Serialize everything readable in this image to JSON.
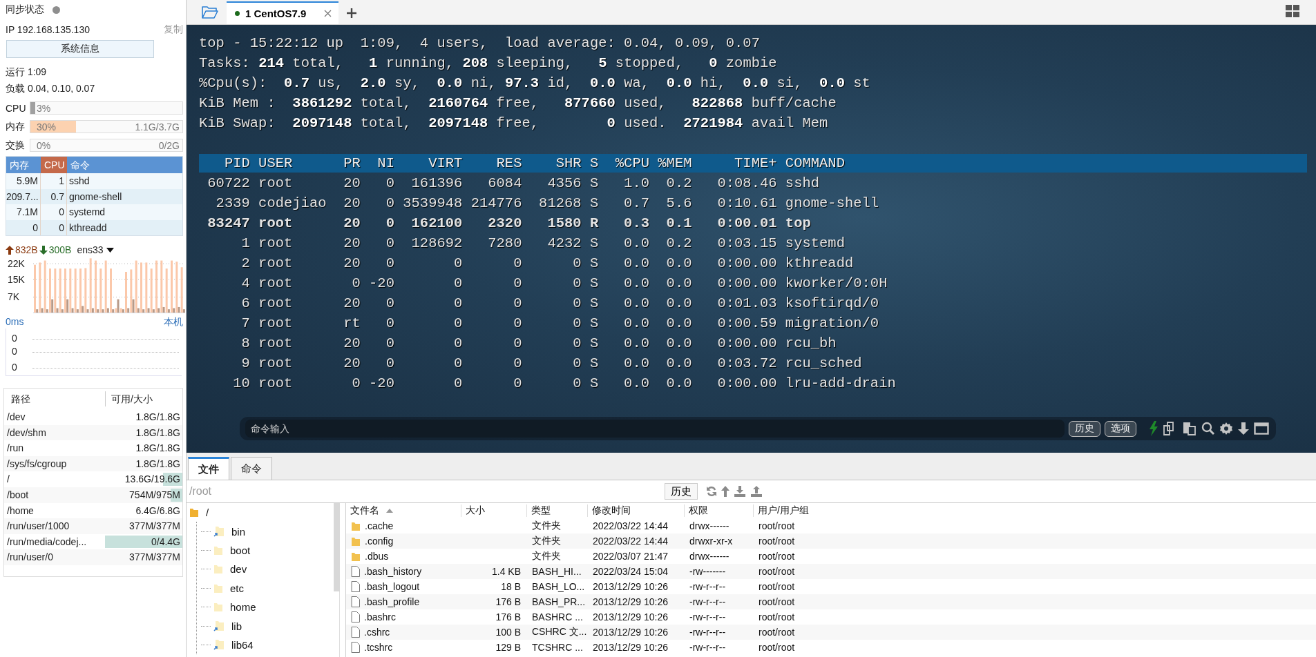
{
  "sidebar": {
    "sync_label": "同步状态",
    "sync_active": false,
    "ip": "IP 192.168.135.130",
    "copy_link": "复制",
    "sysinfo_button": "系统信息",
    "uptime": "运行 1:09",
    "load": "负载 0.04, 0.10, 0.07",
    "meters": [
      {
        "label": "CPU",
        "level": 0.03,
        "color": "#a0a0a0",
        "percent": "3%"
      },
      {
        "label": "内存",
        "level": 0.3,
        "color": "#fcd2b0",
        "percent": "30%",
        "amount": "1.1G/3.7G"
      },
      {
        "label": "交换",
        "level": 0,
        "percent": "0%",
        "amount": "0/2G"
      }
    ],
    "process_table": {
      "columns": [
        {
          "label": "内存",
          "sorted": false
        },
        {
          "label": "CPU",
          "sorted": true
        },
        {
          "label": "命令",
          "sorted": false
        }
      ],
      "rows": [
        [
          "5.9M",
          "1",
          "sshd"
        ],
        [
          "209.7...",
          "0.7",
          "gnome-shell"
        ],
        [
          "7.1M",
          "0",
          "systemd"
        ],
        [
          "0",
          "0",
          "kthreadd"
        ]
      ]
    },
    "network": {
      "upload": "832B",
      "download": "300B",
      "interface": "ens33",
      "chart_data": {
        "type": "bar",
        "grid": true,
        "ylim": [
          0,
          24.5
        ],
        "yticks": [
          {
            "value": 7,
            "label": "7K"
          },
          {
            "value": 15,
            "label": "15K"
          },
          {
            "value": 22,
            "label": "22K"
          }
        ],
        "series": [
          {
            "color": "#fbc8aa",
            "values": [
              21.5,
              22.5,
              23.4,
              19.8,
              19.8,
              19.8,
              19.8,
              19.8,
              19.8,
              19.8,
              20,
              24.4,
              23.4,
              19.8,
              23.4,
              19.8,
              2,
              2,
              18.3,
              19.4,
              23.4,
              22.5,
              22.5,
              19.8,
              23.4,
              23.4,
              19.8,
              23.4,
              22.9,
              20.4
            ]
          },
          {
            "color": "#b89a88",
            "values": [
              1.5,
              2,
              1.5,
              6,
              2,
              1.5,
              6,
              2,
              1.5,
              3,
              1.5,
              2,
              1.5,
              1.5,
              2,
              1.5,
              6,
              1.5,
              2,
              6,
              2,
              1.5,
              2,
              1.5,
              2,
              2.5,
              1.5,
              2,
              2.5,
              1.5
            ]
          }
        ]
      }
    },
    "ping": {
      "latency": "0ms",
      "host": "本机",
      "labels": [
        "0",
        "0",
        "0"
      ]
    },
    "disks": {
      "columns": [
        "路径",
        "可用/大小"
      ],
      "rows": [
        {
          "path": "/dev",
          "size": "1.8G/1.8G"
        },
        {
          "path": "/dev/shm",
          "size": "1.8G/1.8G"
        },
        {
          "path": "/run",
          "size": "1.8G/1.8G"
        },
        {
          "path": "/sys/fs/cgroup",
          "size": "1.8G/1.8G"
        },
        {
          "path": "/",
          "size": "13.6G/19.6G",
          "level": 0.25
        },
        {
          "path": "/boot",
          "size": "754M/975M",
          "level": 0.15
        },
        {
          "path": "/home",
          "size": "6.4G/6.8G"
        },
        {
          "path": "/run/user/1000",
          "size": "377M/377M"
        },
        {
          "path": "/run/media/codej...",
          "size": "0/4.4G",
          "level": 1
        },
        {
          "path": "/run/user/0",
          "size": "377M/377M"
        }
      ]
    }
  },
  "tabs": [
    {
      "label": "1 CentOS7.9",
      "selected": true,
      "connected": true
    }
  ],
  "terminal": {
    "lines": [
      "top - 15:22:12 up  1:09,  4 users,  load average: 0.04, 0.09, 0.07",
      "Tasks: **214** total,   **1** running, **208** sleeping,   **5** stopped,   **0** zombie",
      "%Cpu(s):  **0.7** us,  **2.0** sy,  **0.0** ni, **97.3** id,  **0.0** wa,  **0.0** hi,  **0.0** si,  **0.0** st",
      "KiB Mem :  **3861292** total,  **2160764** free,   **877660** used,   **822868** buff/cache",
      "KiB Swap:  **2097148** total,  **2097148** free,        **0** used.  **2721984** avail Mem"
    ],
    "header": "   PID USER      PR  NI    VIRT    RES    SHR S  %CPU %MEM     TIME+ COMMAND",
    "processes": [
      {
        "text": " 60722 root      20   0  161396   6084   4356 S   1.0  0.2   0:08.46 sshd",
        "bold": false
      },
      {
        "text": "  2339 codejiao  20   0 3539948 214776  81268 S   0.7  5.6   0:10.61 gnome-shell",
        "bold": false
      },
      {
        "text": " 83247 root      20   0  162100   2320   1580 R   0.3  0.1   0:00.01 top",
        "bold": true
      },
      {
        "text": "     1 root      20   0  128692   7280   4232 S   0.0  0.2   0:03.15 systemd",
        "bold": false
      },
      {
        "text": "     2 root      20   0       0      0      0 S   0.0  0.0   0:00.00 kthreadd",
        "bold": false
      },
      {
        "text": "     4 root       0 -20       0      0      0 S   0.0  0.0   0:00.00 kworker/0:0H",
        "bold": false
      },
      {
        "text": "     6 root      20   0       0      0      0 S   0.0  0.0   0:01.03 ksoftirqd/0",
        "bold": false
      },
      {
        "text": "     7 root      rt   0       0      0      0 S   0.0  0.0   0:00.59 migration/0",
        "bold": false
      },
      {
        "text": "     8 root      20   0       0      0      0 S   0.0  0.0   0:00.00 rcu_bh",
        "bold": false
      },
      {
        "text": "     9 root      20   0       0      0      0 S   0.0  0.0   0:03.72 rcu_sched",
        "bold": false
      },
      {
        "text": "    10 root       0 -20       0      0      0 S   0.0  0.0   0:00.00 lru-add-drain",
        "bold": false
      }
    ],
    "command_input": {
      "placeholder": "命令输入",
      "buttons": [
        "历史",
        "选项"
      ]
    }
  },
  "file_pane": {
    "tabs": [
      {
        "label": "文件",
        "selected": true
      },
      {
        "label": "命令",
        "selected": false
      }
    ],
    "path": "/root",
    "history_button": "历史",
    "tree": {
      "label": "/",
      "kind": "root",
      "children": [
        {
          "label": "bin",
          "kind": "link"
        },
        {
          "label": "boot",
          "kind": "folder"
        },
        {
          "label": "dev",
          "kind": "folder"
        },
        {
          "label": "etc",
          "kind": "folder"
        },
        {
          "label": "home",
          "kind": "folder"
        },
        {
          "label": "lib",
          "kind": "link"
        },
        {
          "label": "lib64",
          "kind": "link"
        }
      ]
    },
    "columns": [
      {
        "label": "文件名",
        "sorted": true
      },
      {
        "label": "大小",
        "sorted": false
      },
      {
        "label": "类型",
        "sorted": false
      },
      {
        "label": "修改时间",
        "sorted": false
      },
      {
        "label": "权限",
        "sorted": false
      },
      {
        "label": "用户/用户组",
        "sorted": false
      }
    ],
    "rows": [
      {
        "name": ".cache",
        "kind": "folder",
        "type": "文件夹",
        "modified": "2022/03/22 14:44",
        "permissions": "drwx------",
        "owner": "root/root"
      },
      {
        "name": ".config",
        "kind": "folder",
        "type": "文件夹",
        "modified": "2022/03/22 14:44",
        "permissions": "drwxr-xr-x",
        "owner": "root/root"
      },
      {
        "name": ".dbus",
        "kind": "folder",
        "type": "文件夹",
        "modified": "2022/03/07 21:47",
        "permissions": "drwx------",
        "owner": "root/root"
      },
      {
        "name": ".bash_history",
        "kind": "file",
        "size": "1.4 KB",
        "type": "BASH_HI...",
        "modified": "2022/03/24 15:04",
        "permissions": "-rw-------",
        "owner": "root/root"
      },
      {
        "name": ".bash_logout",
        "kind": "file",
        "size": "18 B",
        "type": "BASH_LO...",
        "modified": "2013/12/29 10:26",
        "permissions": "-rw-r--r--",
        "owner": "root/root"
      },
      {
        "name": ".bash_profile",
        "kind": "file",
        "size": "176 B",
        "type": "BASH_PR...",
        "modified": "2013/12/29 10:26",
        "permissions": "-rw-r--r--",
        "owner": "root/root"
      },
      {
        "name": ".bashrc",
        "kind": "file",
        "size": "176 B",
        "type": "BASHRC ...",
        "modified": "2013/12/29 10:26",
        "permissions": "-rw-r--r--",
        "owner": "root/root"
      },
      {
        "name": ".cshrc",
        "kind": "file",
        "size": "100 B",
        "type": "CSHRC 文...",
        "modified": "2013/12/29 10:26",
        "permissions": "-rw-r--r--",
        "owner": "root/root"
      },
      {
        "name": ".tcshrc",
        "kind": "file",
        "size": "129 B",
        "type": "TCSHRC ...",
        "modified": "2013/12/29 10:26",
        "permissions": "-rw-r--r--",
        "owner": "root/root"
      }
    ]
  }
}
